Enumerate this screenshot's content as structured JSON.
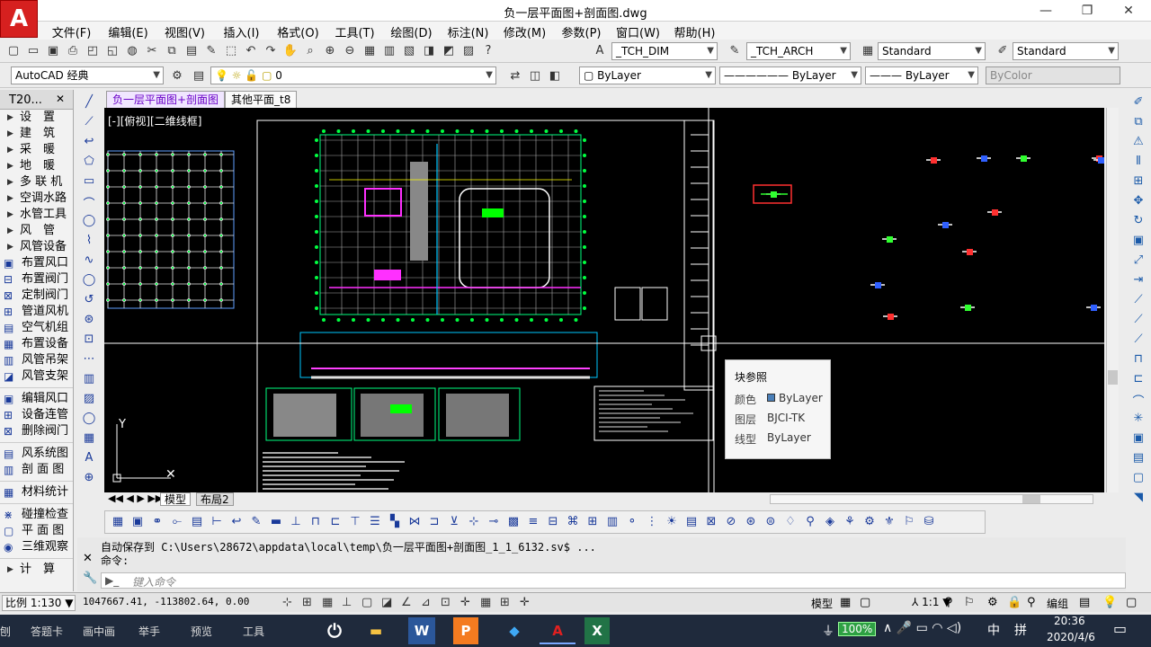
{
  "window": {
    "title": "负一层平面图+剖面图.dwg",
    "logo_letter": "A",
    "minimize": "—",
    "restore": "❐",
    "close": "✕"
  },
  "menu": [
    "文件(F)",
    "编辑(E)",
    "视图(V)",
    "插入(I)",
    "格式(O)",
    "工具(T)",
    "绘图(D)",
    "标注(N)",
    "修改(M)",
    "参数(P)",
    "窗口(W)",
    "帮助(H)"
  ],
  "toolbar1": {
    "dim_style": "_TCH_DIM",
    "arch_style": "_TCH_ARCH",
    "text_style": "Standard",
    "table_style": "Standard"
  },
  "toolbar2": {
    "workspace": "AutoCAD 经典",
    "layer": "0",
    "color": "ByLayer",
    "linetype": "ByLayer",
    "lineweight": "ByLayer",
    "plotstyle": "ByColor"
  },
  "leftpanel": {
    "header": "T20...",
    "close": "✕",
    "groups": [
      {
        "label": "设　置"
      },
      {
        "label": "建　筑"
      },
      {
        "label": "采　暖"
      },
      {
        "label": "地　暖"
      },
      {
        "label": "多 联 机"
      },
      {
        "label": "空调水路"
      },
      {
        "label": "水管工具"
      },
      {
        "label": "风　管"
      },
      {
        "label": "风管设备"
      }
    ],
    "tools": [
      {
        "label": "布置风口",
        "icon": "▣"
      },
      {
        "label": "布置阀门",
        "icon": "⊟"
      },
      {
        "label": "定制阀门",
        "icon": "⊠"
      },
      {
        "label": "管道风机",
        "icon": "⊞"
      },
      {
        "label": "空气机组",
        "icon": "▤"
      },
      {
        "label": "布置设备",
        "icon": "▦"
      },
      {
        "label": "风管吊架",
        "icon": "▥"
      },
      {
        "label": "风管支架",
        "icon": "◪"
      }
    ],
    "tools2": [
      {
        "label": "编辑风口",
        "icon": "▣"
      },
      {
        "label": "设备连管",
        "icon": "⊞"
      },
      {
        "label": "删除阀门",
        "icon": "⊠"
      }
    ],
    "tools3": [
      {
        "label": "风系统图",
        "icon": "▤"
      },
      {
        "label": "剖 面 图",
        "icon": "▥"
      }
    ],
    "tools4": [
      {
        "label": "材料统计",
        "icon": "▦"
      }
    ],
    "tools5": [
      {
        "label": "碰撞检查",
        "icon": "⋇"
      },
      {
        "label": "平 面 图",
        "icon": "▢"
      },
      {
        "label": "三维观察",
        "icon": "◉"
      }
    ],
    "footer": "计　算"
  },
  "doc_tabs": [
    "负一层平面图+剖面图",
    "其他平面_t8"
  ],
  "viewport_label": "[-][俯视][二维线框]",
  "tooltip": {
    "title": "块参照",
    "rows": [
      {
        "label": "颜色",
        "value": "ByLayer"
      },
      {
        "label": "图层",
        "value": "BJCI-TK"
      },
      {
        "label": "线型",
        "value": "ByLayer"
      }
    ]
  },
  "layout_tabs": [
    "模型",
    "布局2"
  ],
  "command": {
    "history": "自动保存到 C:\\Users\\28672\\appdata\\local\\temp\\负一层平面图+剖面图_1_1_6132.sv$ ...\n命令:",
    "placeholder": "键入命令"
  },
  "status": {
    "scale": "比例 1:130",
    "coords": "1047667.41, -113802.64, 0.00",
    "model": "模型",
    "annoscale": "1:1",
    "edit_label": "编组"
  },
  "taskbar": {
    "items": [
      "刨",
      "答题卡",
      "画中画",
      "举手",
      "预览",
      "工具"
    ],
    "battery": "100%",
    "ime": "中",
    "ime2": "拼",
    "time": "20:36",
    "date": "2020/4/6"
  },
  "colors": {
    "accent": "#d6201f",
    "canvas": "#000000",
    "taskbar": "#1f2a3c"
  }
}
